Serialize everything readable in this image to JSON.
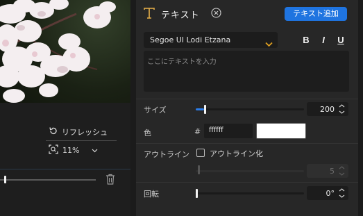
{
  "preview": {
    "refresh_label": "リフレッシュ",
    "zoom_value": "11%"
  },
  "panel": {
    "title": "テキスト",
    "add_button": "テキスト追加",
    "font": "Segoe UI Lodi Etzana",
    "format": {
      "bold": "B",
      "italic": "I",
      "underline": "U"
    },
    "text_placeholder": "ここにテキストを入力",
    "size": {
      "label": "サイズ",
      "value": "200",
      "fraction": 0.08
    },
    "color": {
      "label": "色",
      "hash": "#",
      "hex": "ffffff",
      "swatch": "#ffffff"
    },
    "outline": {
      "label": "アウトライン",
      "checkbox_label": "アウトライン化",
      "checked": false,
      "value": "5"
    },
    "rotation": {
      "label": "回転",
      "value": "0°",
      "fraction": 0.0
    }
  },
  "colors": {
    "accent": "#1f74e0",
    "slider_fill": "#2b7de9",
    "title_icon": "#e8b04a",
    "dropdown_arrow": "#e0a020"
  },
  "icons": [
    "text-t-icon",
    "close-circle-icon",
    "chevron-down-icon",
    "refresh-icon",
    "zoom-fit-icon",
    "trash-icon",
    "spinner-icon"
  ]
}
